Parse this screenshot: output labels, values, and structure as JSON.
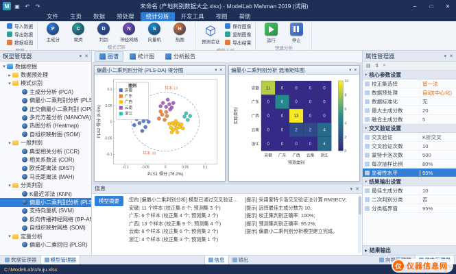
{
  "glyphs": {
    "menu": "≡",
    "chevron_down": "▾",
    "chevron_right": "▸",
    "close": "✕",
    "min": "−",
    "max": "□",
    "search": "⌕",
    "sort": "⇅",
    "grid": "▤",
    "undo": "↶",
    "redo": "↷",
    "save": "▣"
  },
  "titlebar": {
    "app_abbr": "M",
    "title": "未命名 (产地判别数据大全.xlsx) - ModelLab Mahman 2019 (试用)"
  },
  "menu_tabs": [
    {
      "label": "文件"
    },
    {
      "label": "主页"
    },
    {
      "label": "数据"
    },
    {
      "label": "预处理"
    },
    {
      "label": "统计分析",
      "active": true
    },
    {
      "label": "开发工具"
    },
    {
      "label": "视图"
    },
    {
      "label": "帮助"
    }
  ],
  "ribbon": {
    "groups": [
      {
        "name": "数据",
        "stack": [
          {
            "label": "导入数据",
            "color": "#2f7fd9"
          },
          {
            "label": "导出数据",
            "color": "#2aa198"
          },
          {
            "label": "数据视图",
            "color": "#e07b39"
          }
        ]
      },
      {
        "name": "模式识别",
        "items": [
          {
            "label": "主成分",
            "abbr": "P",
            "color": "#2f7fd9"
          },
          {
            "label": "聚类",
            "abbr": "C",
            "color": "#2aa198"
          },
          {
            "label": "判别",
            "abbr": "D",
            "color": "#3558a8"
          },
          {
            "label": "神经网络",
            "abbr": "N",
            "color": "#7a4fc9"
          },
          {
            "label": "向量机",
            "abbr": "S",
            "color": "#1f8fd0"
          },
          {
            "label": "热图",
            "abbr": "H",
            "color": "#e07b39"
          }
        ]
      },
      {
        "name": "模型工具",
        "cube": {
          "label": "预测验证"
        },
        "stack": [
          {
            "label": "保存图像",
            "color": "#2f7fd9"
          },
          {
            "label": "复制图像",
            "color": "#2aa198"
          },
          {
            "label": "导出结果",
            "color": "#e07b39"
          }
        ]
      },
      {
        "name": "快速分析",
        "items": [
          {
            "label": "运行",
            "glyph": "play",
            "color": "#35a853"
          },
          {
            "label": "停止",
            "glyph": "pause",
            "color": "#3b6bc7"
          }
        ]
      }
    ]
  },
  "model_manager": {
    "title": "模型管理器",
    "tree": [
      {
        "label": "数据挖掘",
        "type": "root",
        "expanded": true
      },
      {
        "label": "数据预处理",
        "type": "group",
        "expanded": false
      },
      {
        "label": "模式识别",
        "type": "group",
        "expanded": true
      },
      {
        "label": "主成分分析 (PCA)",
        "type": "item"
      },
      {
        "label": "偏最小二乘判别分析 (PLSDA)",
        "type": "item"
      },
      {
        "label": "正交偏最小二乘判别 (OPLSDA)",
        "type": "item"
      },
      {
        "label": "多元方差分析 (MANOVA)",
        "type": "item"
      },
      {
        "label": "热图分析 (Heatmap)",
        "type": "item"
      },
      {
        "label": "自组织映射图 (SOM)",
        "type": "item"
      },
      {
        "label": "一般判别",
        "type": "group",
        "expanded": true
      },
      {
        "label": "典型相关分析 (CCR)",
        "type": "item"
      },
      {
        "label": "相关系数法 (COR)",
        "type": "item"
      },
      {
        "label": "欧氏距离法 (DIST)",
        "type": "item"
      },
      {
        "label": "马氏距离法 (MAH)",
        "type": "item"
      },
      {
        "label": "分类判别",
        "type": "group",
        "expanded": true
      },
      {
        "label": "K最近邻法 (KNN)",
        "type": "item"
      },
      {
        "label": "偏最小二乘判别分析 (PLS-DA)",
        "type": "item",
        "selected": true
      },
      {
        "label": "支持向量机 (SVM)",
        "type": "item"
      },
      {
        "label": "反向传播神经网络 (BP-ANN)",
        "type": "item"
      },
      {
        "label": "自组织映射网络 (SOM)",
        "type": "item"
      },
      {
        "label": "定量分析",
        "type": "group",
        "expanded": true
      },
      {
        "label": "偏最小二乘回归 (PLSR)",
        "type": "item"
      }
    ]
  },
  "document": {
    "toolbar": [
      {
        "label": "图谱",
        "active": true
      },
      {
        "label": "统计图"
      },
      {
        "label": "分析报告"
      }
    ]
  },
  "scatter": {
    "window_title": "偏最小二乘判别分析 (PLS-DA) 得分图",
    "xlabel": "PLS1 得分 (76.2%)",
    "ylabel": "PLS2 得分 (8.5%)",
    "xticks": [
      -0.1,
      -0.05,
      0,
      0.05,
      0.1
    ],
    "yticks": [
      -0.1,
      -0.05,
      0,
      0.05,
      0.1
    ],
    "xlim": [
      -0.13,
      0.13
    ],
    "ylim": [
      -0.13,
      0.13
    ],
    "legend_title": "图例",
    "classes": [
      {
        "name": "安徽",
        "color": "#4472c4"
      },
      {
        "name": "广东",
        "color": "#ed7d31"
      },
      {
        "name": "广西",
        "color": "#ffc000"
      },
      {
        "name": "云南",
        "color": "#9b59b6"
      },
      {
        "name": "浙江",
        "color": "#2ec4b6"
      }
    ],
    "ellipse": {
      "cx": 0,
      "cy": 0,
      "rx": 0.085,
      "ry": 0.09
    },
    "annotations": [
      {
        "text": "样本 13",
        "x": 0.015,
        "y": 0.1
      },
      {
        "text": "样本 33",
        "x": -0.04,
        "y": -0.1
      }
    ],
    "points": [
      [
        -0.072,
        0.008,
        0
      ],
      [
        -0.065,
        -0.004,
        0
      ],
      [
        -0.06,
        0.018,
        0
      ],
      [
        -0.055,
        0.002,
        0
      ],
      [
        -0.05,
        -0.016,
        0
      ],
      [
        -0.047,
        0.01,
        0
      ],
      [
        -0.058,
        -0.028,
        0
      ],
      [
        -0.042,
        0.0,
        0
      ],
      [
        -0.078,
        -0.01,
        0
      ],
      [
        -0.068,
        0.024,
        0
      ],
      [
        -0.052,
        0.03,
        0
      ],
      [
        -0.016,
        0.01,
        1
      ],
      [
        -0.008,
        0.022,
        1
      ],
      [
        -0.002,
        0.006,
        1
      ],
      [
        0.004,
        0.018,
        1
      ],
      [
        -0.012,
        0.032,
        1
      ],
      [
        0.002,
        0.03,
        1
      ],
      [
        0.01,
        -0.006,
        2
      ],
      [
        0.014,
        -0.018,
        2
      ],
      [
        0.018,
        -0.004,
        2
      ],
      [
        0.02,
        -0.024,
        2
      ],
      [
        0.024,
        -0.01,
        2
      ],
      [
        0.028,
        -0.02,
        2
      ],
      [
        0.032,
        -0.006,
        2
      ],
      [
        0.026,
        0.002,
        2
      ],
      [
        0.036,
        -0.016,
        2
      ],
      [
        0.04,
        -0.008,
        2
      ],
      [
        0.016,
        -0.032,
        2
      ],
      [
        0.03,
        -0.032,
        2
      ],
      [
        0.044,
        -0.02,
        2
      ],
      [
        0.002,
        0.046,
        3
      ],
      [
        0.01,
        0.054,
        3
      ],
      [
        -0.006,
        0.058,
        3
      ],
      [
        0.016,
        0.044,
        3
      ],
      [
        0.006,
        0.068,
        3
      ],
      [
        -0.012,
        0.048,
        3
      ],
      [
        0.02,
        0.058,
        3
      ],
      [
        0.012,
        0.038,
        3
      ],
      [
        0.048,
        0.016,
        4
      ],
      [
        0.056,
        0.006,
        4
      ],
      [
        0.052,
        0.026,
        4
      ],
      [
        0.062,
        0.018,
        4
      ]
    ]
  },
  "confusion": {
    "window_title": "偏最小二乘判别分析 混淆矩阵图",
    "xlabel": "预测类别",
    "ylabel": "实际类别",
    "classes": [
      "安徽",
      "广东",
      "广西",
      "云南",
      "浙江"
    ],
    "matrix": [
      [
        11,
        0,
        0,
        0,
        0
      ],
      [
        0,
        6,
        0,
        0,
        0
      ],
      [
        0,
        0,
        13,
        0,
        0
      ],
      [
        0,
        0,
        2,
        2,
        4
      ],
      [
        0,
        0,
        0,
        0,
        4
      ]
    ],
    "colorbar_ticks": [
      0,
      2,
      4,
      6,
      8,
      10
    ],
    "vmax": 13
  },
  "info": {
    "title": "信息",
    "summary_tab": "模型摘要",
    "left_lines": [
      "您的 [偏最小二乘判别分析] 模型已通过交叉验证建立完成 (共 42 个样本):",
      "安徽: 11 个样本 (校正集 8 个; 预测集 3 个)",
      "广东: 6 个样本 (校正集 4 个; 预测集 2 个)",
      "广西: 13 个样本 (校正集 9 个; 预测集 4 个)",
      "云南: 8 个样本 (校正集 6 个; 预测集 2 个)",
      "浙江: 4 个样本 (校正集 3 个; 预测集 1 个)"
    ],
    "right_lines": [
      "[提示] 采用蒙特卡洛交叉验证法计算 RMSECV;",
      "[提示] 选择最佳主成分数为 10;",
      "[提示] 校正集判别正确率: 100%;",
      "[提示] 预测集判别正确率: 95.2%;",
      "[提示] 偏最小二乘判别分析模型建立完成。"
    ]
  },
  "property_manager": {
    "title": "属性管理器",
    "sections": [
      {
        "name": "核心参数设置",
        "rows": [
          {
            "label": "校正集选择",
            "value": "留一法",
            "accent": true
          },
          {
            "label": "数据预处理",
            "value": "自动(中心化)",
            "accent": true
          },
          {
            "label": "数据标准化",
            "value": "无"
          },
          {
            "label": "最大主成分数",
            "value": "20"
          },
          {
            "label": "融合主成分数",
            "value": "5"
          }
        ]
      },
      {
        "name": "交叉验证设置",
        "rows": [
          {
            "label": "交叉验证",
            "value": "K折交叉"
          },
          {
            "label": "交叉验证次数",
            "value": "10"
          },
          {
            "label": "蒙特卡洛次数",
            "value": "500"
          },
          {
            "label": "每次抽样比例",
            "value": "80%"
          },
          {
            "label": "显著性水平",
            "value": "95%",
            "selected": true
          }
        ]
      },
      {
        "name": "结果输出设置",
        "rows": [
          {
            "label": "最佳主成分数",
            "value": "10"
          },
          {
            "label": "二次判别分类",
            "value": "否"
          },
          {
            "label": "分类临界值",
            "value": "95%"
          }
        ]
      }
    ],
    "footer": "结果输出"
  },
  "bottom_tabs": {
    "left": [
      {
        "label": "数据管理器"
      },
      {
        "label": "模型管理器",
        "active": true
      }
    ],
    "center": [
      {
        "label": "信息",
        "active": true
      },
      {
        "label": "输出"
      }
    ],
    "right": [
      {
        "label": "向导管理器"
      },
      {
        "label": "属性管理器",
        "active": true
      }
    ]
  },
  "statusbar": {
    "path": "C:\\ModelLab\\shuju.xlsx",
    "icons": [
      "▤",
      "▥",
      "◧"
    ]
  },
  "watermark": {
    "logo_abbr": "仪",
    "text": "仪器信息网"
  }
}
